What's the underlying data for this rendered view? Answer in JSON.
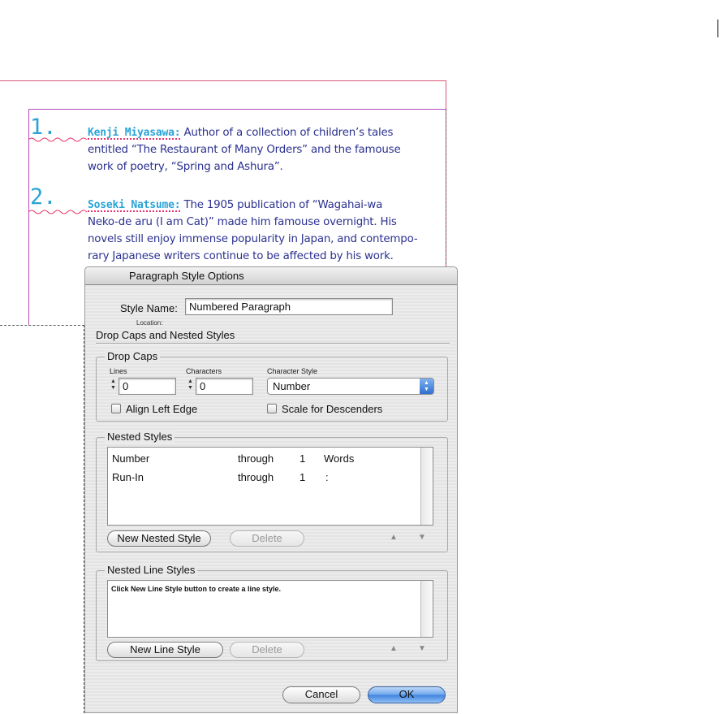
{
  "document": {
    "items": [
      {
        "number": "1.",
        "runin": "Kenji Miyasawa:",
        "lines": [
          " Author of a collection of children’s tales",
          "entitled “The Restaurant of Many Orders” and the famouse",
          "work of poetry, “Spring and Ashura”."
        ]
      },
      {
        "number": "2.",
        "runin": "Soseki Natsume:",
        "lines": [
          " The 1905 publication of “Wagahai-wa",
          "Neko-de aru (I am Cat)” made him famouse overnight. His",
          "novels still enjoy immense popularity in Japan, and contempo-",
          "rary Japanese writers continue to be affected by his work."
        ]
      }
    ]
  },
  "dialog": {
    "title": "Paragraph Style Options",
    "style_name_label": "Style Name:",
    "style_name_value": "Numbered Paragraph",
    "location_label": "Location:",
    "section_title": "Drop Caps and Nested Styles",
    "drop_caps": {
      "title": "Drop Caps",
      "lines_label": "Lines",
      "lines_value": "0",
      "characters_label": "Characters",
      "characters_value": "0",
      "char_style_label": "Character Style",
      "char_style_value": "Number",
      "align_left_edge": "Align Left Edge",
      "scale_for_descenders": "Scale for Descenders"
    },
    "nested_styles": {
      "title": "Nested Styles",
      "rows": [
        {
          "style": "Number",
          "mode": "through",
          "count": "1",
          "unit": "Words"
        },
        {
          "style": "Run-In",
          "mode": "through",
          "count": "1",
          "unit": ":"
        }
      ],
      "new_button": "New Nested Style",
      "delete_button": "Delete"
    },
    "nested_line_styles": {
      "title": "Nested Line Styles",
      "hint": "Click New Line Style button to create a line style.",
      "new_button": "New Line Style",
      "delete_button": "Delete"
    },
    "cancel_button": "Cancel",
    "ok_button": "OK",
    "up_arrow": "▲",
    "down_arrow": "▼"
  }
}
